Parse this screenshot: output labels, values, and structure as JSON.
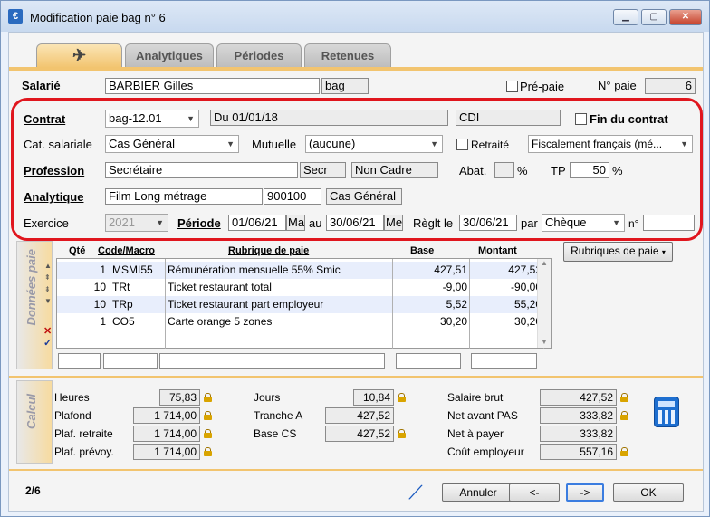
{
  "window": {
    "title": "Modification paie bag n° 6",
    "icon": "€"
  },
  "tabs": [
    {
      "label": "",
      "icon": "plane-icon"
    },
    {
      "label": "Analytiques"
    },
    {
      "label": "Périodes"
    },
    {
      "label": "Retenues"
    }
  ],
  "header": {
    "salarie_label": "Salarié",
    "salarie_name": "BARBIER Gilles",
    "salarie_code": "bag",
    "prepaie_label": "Pré-paie",
    "npaie_label": "N° paie",
    "npaie_value": "6"
  },
  "contrat": {
    "contrat_label": "Contrat",
    "contrat_value": "bag-12.01",
    "contrat_du": "Du 01/01/18",
    "contrat_type": "CDI",
    "fin_label": "Fin du contrat",
    "cat_label": "Cat. salariale",
    "cat_value": "Cas Général",
    "mutuelle_label": "Mutuelle",
    "mutuelle_value": "(aucune)",
    "retraite_label": "Retraité",
    "fiscal_value": "Fiscalement français (mé...",
    "profession_label": "Profession",
    "profession_value": "Secrétaire",
    "profession_code": "Secr",
    "profession_cadre": "Non Cadre",
    "abat_label": "Abat.",
    "abat_value": "",
    "pct": "%",
    "tp_label": "TP",
    "tp_value": "50",
    "pct2": "%",
    "analytique_label": "Analytique",
    "analytique_value": "Film Long métrage",
    "analytique_code": "900100",
    "analytique_cat": "Cas Général",
    "exercice_label": "Exercice",
    "exercice_value": "2021",
    "periode_label": "Période",
    "periode_from": "01/06/21",
    "periode_from_day": "Ma",
    "au_label": "au",
    "periode_to": "30/06/21",
    "periode_to_day": "Me",
    "reglt_label": "Règlt le",
    "reglt_date": "30/06/21",
    "par_label": "par",
    "reglt_mode": "Chèque",
    "no_label": "n°",
    "no_value": ""
  },
  "donnees": {
    "side_label": "Données paie",
    "columns": {
      "qte": "Qté",
      "code": "Code/Macro",
      "rubrique": "Rubrique de paie",
      "base": "Base",
      "montant": "Montant"
    },
    "rubriques_button": "Rubriques de paie",
    "rows": [
      {
        "qte": "1",
        "code": "MSMI55",
        "rubrique": "Rémunération mensuelle 55% Smic",
        "base": "427,51",
        "montant": "427,52"
      },
      {
        "qte": "10",
        "code": "TRt",
        "rubrique": "Ticket restaurant total",
        "base": "-9,00",
        "montant": "-90,00"
      },
      {
        "qte": "10",
        "code": "TRp",
        "rubrique": "Ticket restaurant part employeur",
        "base": "5,52",
        "montant": "55,20"
      },
      {
        "qte": "1",
        "code": "CO5",
        "rubrique": "Carte orange 5 zones",
        "base": "30,20",
        "montant": "30,20"
      }
    ]
  },
  "calcul": {
    "side_label": "Calcul",
    "heures_label": "Heures",
    "heures": "75,83",
    "plafond_label": "Plafond",
    "plafond": "1 714,00",
    "plaf_retraite_label": "Plaf. retraite",
    "plaf_retraite": "1 714,00",
    "plaf_prevoy_label": "Plaf. prévoy.",
    "plaf_prevoy": "1 714,00",
    "jours_label": "Jours",
    "jours": "10,84",
    "tranche_label": "Tranche A",
    "tranche": "427,52",
    "basecs_label": "Base CS",
    "basecs": "427,52",
    "brut_label": "Salaire brut",
    "brut": "427,52",
    "netpas_label": "Net avant PAS",
    "netpas": "333,82",
    "netpayer_label": "Net à payer",
    "netpayer": "333,82",
    "cout_label": "Coût employeur",
    "cout": "557,16"
  },
  "footer": {
    "page": "2/6",
    "annuler": "Annuler",
    "prev": "<-",
    "next": "->",
    "ok": "OK"
  }
}
